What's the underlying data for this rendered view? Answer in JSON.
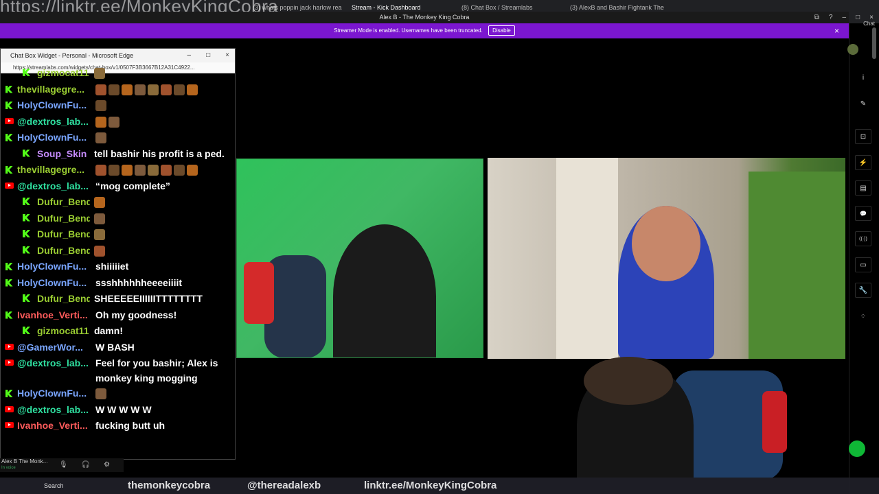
{
  "overlay_text": {
    "top_url": "https://linktr.ee/MonkeyKingCobra",
    "bottom_url": "linktr.ee/MonkeyKingCobra",
    "bottom_handle_1": "themonkeycobra",
    "bottom_handle_2": "@thereadalexb"
  },
  "browser_tabs": [
    {
      "label": "(3) whats poppin jack harlow rea",
      "close": "×"
    },
    {
      "label": "Stream - Kick Dashboard",
      "close": "×"
    },
    {
      "label": "(8) Chat Box / Streamlabs",
      "close": "×"
    },
    {
      "label": "(3) AlexB and Bashir Fightank The",
      "close": "×"
    }
  ],
  "window": {
    "title": "Alex B - The Monkey King Cobra",
    "controls": [
      "⧉",
      "?",
      "–",
      "□",
      "×"
    ]
  },
  "streamer_mode": {
    "message": "Streamer Mode is enabled. Usernames have been truncated.",
    "disable_label": "Disable",
    "close": "×"
  },
  "right_rail": {
    "chat_label": "Chat",
    "buttons": [
      "i",
      "✎",
      "⊡",
      "⚡",
      "▤",
      "💬",
      "((·))",
      "▭",
      "🔧",
      "⁘"
    ],
    "accent_color": "#0fb836"
  },
  "edge_window": {
    "title": "Chat Box Widget - Personal - Microsoft Edge",
    "url": "https://streamlabs.com/widgets/chat-box/v1/0507F3B3667B12A31C4922...",
    "controls": [
      "–",
      "□",
      "×"
    ]
  },
  "chat": {
    "messages": [
      {
        "platform": "kick",
        "user": "gizmocat11",
        "user_color": "#9acd32",
        "text": "",
        "indent": true,
        "emotes": 1
      },
      {
        "platform": "kick",
        "user": "thevillagegre...",
        "user_color": "#9acd32",
        "text": "",
        "indent": false,
        "emotes": 8
      },
      {
        "platform": "kick",
        "user": "HolyClownFu...",
        "user_color": "#7aa6ff",
        "text": "",
        "indent": false,
        "emotes": 1
      },
      {
        "platform": "youtube",
        "user": "@dextros_lab...",
        "user_color": "#2fe0a0",
        "text": "",
        "indent": false,
        "emotes": 2
      },
      {
        "platform": "kick",
        "user": "HolyClownFu...",
        "user_color": "#7aa6ff",
        "text": "",
        "indent": false,
        "emotes": 1
      },
      {
        "platform": "kick",
        "user": "Soup_Skin",
        "user_color": "#c78cff",
        "text": "tell bashir his profit is a ped.",
        "indent": true,
        "emotes": 0
      },
      {
        "platform": "kick",
        "user": "thevillagegre...",
        "user_color": "#9acd32",
        "text": "",
        "indent": false,
        "emotes": 8
      },
      {
        "platform": "youtube",
        "user": "@dextros_lab...",
        "user_color": "#2fe0a0",
        "text": "“mog complete”",
        "indent": false,
        "emotes": 0
      },
      {
        "platform": "kick",
        "user": "Dufur_Bend",
        "user_color": "#9acd32",
        "text": "",
        "indent": true,
        "emotes": 1
      },
      {
        "platform": "kick",
        "user": "Dufur_Bend",
        "user_color": "#9acd32",
        "text": "",
        "indent": true,
        "emotes": 1
      },
      {
        "platform": "kick",
        "user": "Dufur_Bend",
        "user_color": "#9acd32",
        "text": "",
        "indent": true,
        "emotes": 1
      },
      {
        "platform": "kick",
        "user": "Dufur_Bend",
        "user_color": "#9acd32",
        "text": "",
        "indent": true,
        "emotes": 1
      },
      {
        "platform": "kick",
        "user": "HolyClownFu...",
        "user_color": "#7aa6ff",
        "text": "shiiiiiet",
        "indent": false,
        "emotes": 0
      },
      {
        "platform": "kick",
        "user": "HolyClownFu...",
        "user_color": "#7aa6ff",
        "text": "ssshhhhhheeeeiiiit",
        "indent": false,
        "emotes": 0
      },
      {
        "platform": "kick",
        "user": "Dufur_Bend",
        "user_color": "#9acd32",
        "text": "SHEEEEEIIIIIITTTTTTTT",
        "indent": true,
        "emotes": 0
      },
      {
        "platform": "kick",
        "user": "Ivanhoe_Verti...",
        "user_color": "#ff5b5b",
        "text": "Oh my goodness!",
        "indent": false,
        "emotes": 0
      },
      {
        "platform": "kick",
        "user": "gizmocat11",
        "user_color": "#9acd32",
        "text": "damn!",
        "indent": true,
        "emotes": 0
      },
      {
        "platform": "youtube",
        "user": "@GamerWor...",
        "user_color": "#7aa6ff",
        "text": "W BASH",
        "indent": false,
        "emotes": 0
      },
      {
        "platform": "youtube",
        "user": "@dextros_lab...",
        "user_color": "#2fe0a0",
        "text": "Feel for you bashir; Alex is monkey king mogging",
        "indent": false,
        "emotes": 0
      },
      {
        "platform": "kick",
        "user": "HolyClownFu...",
        "user_color": "#7aa6ff",
        "text": "",
        "indent": false,
        "emotes": 1
      },
      {
        "platform": "youtube",
        "user": "@dextros_lab...",
        "user_color": "#2fe0a0",
        "text": "W W W W W",
        "indent": false,
        "emotes": 0
      },
      {
        "platform": "youtube",
        "user": "Ivanhoe_Verti...",
        "user_color": "#ff5b5b",
        "text": "fucking butt uh",
        "indent": false,
        "emotes": 0
      }
    ]
  },
  "voice": {
    "channel": "Alex B The Monk...",
    "status": "In voice"
  },
  "taskbar": {
    "search_label": "Search"
  }
}
